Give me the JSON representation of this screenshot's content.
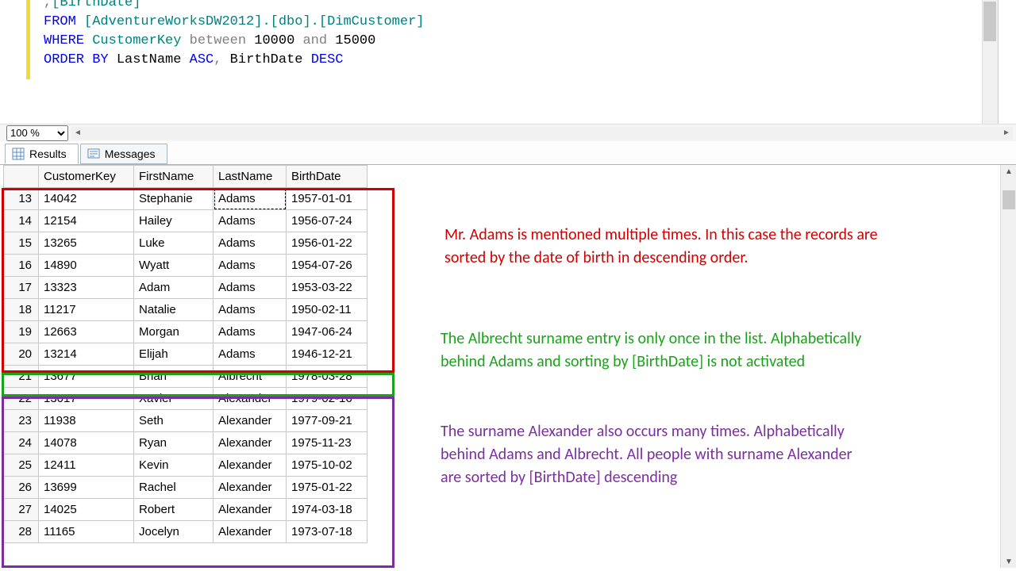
{
  "zoom": "100 %",
  "tabs": {
    "results": "Results",
    "messages": "Messages"
  },
  "sql": {
    "line0_pre": "      ,",
    "line0_col": "[BirthDate]",
    "line1_from": "FROM",
    "line1_db": " [AdventureWorksDW2012].[dbo].[DimCustomer]",
    "line2_where": "WHERE",
    "line2_col": " CustomerKey ",
    "line2_between": "between",
    "line2_space1": " ",
    "line2_n1": "10000",
    "line2_and": " and ",
    "line2_n2": "15000",
    "line3_order": "ORDER",
    "line3_sp1": " ",
    "line3_by": "BY",
    "line3_cols": " LastName ",
    "line3_asc": "ASC",
    "line3_comma": ",",
    "line3_cols2": " BirthDate ",
    "line3_desc": "DESC"
  },
  "columns": [
    "CustomerKey",
    "FirstName",
    "LastName",
    "BirthDate"
  ],
  "rows": [
    {
      "n": 13,
      "ck": "14042",
      "fn": "Stephanie",
      "ln": "Adams",
      "bd": "1957-01-01"
    },
    {
      "n": 14,
      "ck": "12154",
      "fn": "Hailey",
      "ln": "Adams",
      "bd": "1956-07-24"
    },
    {
      "n": 15,
      "ck": "13265",
      "fn": "Luke",
      "ln": "Adams",
      "bd": "1956-01-22"
    },
    {
      "n": 16,
      "ck": "14890",
      "fn": "Wyatt",
      "ln": "Adams",
      "bd": "1954-07-26"
    },
    {
      "n": 17,
      "ck": "13323",
      "fn": "Adam",
      "ln": "Adams",
      "bd": "1953-03-22"
    },
    {
      "n": 18,
      "ck": "11217",
      "fn": "Natalie",
      "ln": "Adams",
      "bd": "1950-02-11"
    },
    {
      "n": 19,
      "ck": "12663",
      "fn": "Morgan",
      "ln": "Adams",
      "bd": "1947-06-24"
    },
    {
      "n": 20,
      "ck": "13214",
      "fn": "Elijah",
      "ln": "Adams",
      "bd": "1946-12-21"
    },
    {
      "n": 21,
      "ck": "13677",
      "fn": "Brian",
      "ln": "Albrecht",
      "bd": "1978-03-28"
    },
    {
      "n": 22,
      "ck": "13017",
      "fn": "Xavier",
      "ln": "Alexander",
      "bd": "1979-02-16"
    },
    {
      "n": 23,
      "ck": "11938",
      "fn": "Seth",
      "ln": "Alexander",
      "bd": "1977-09-21"
    },
    {
      "n": 24,
      "ck": "14078",
      "fn": "Ryan",
      "ln": "Alexander",
      "bd": "1975-11-23"
    },
    {
      "n": 25,
      "ck": "12411",
      "fn": "Kevin",
      "ln": "Alexander",
      "bd": "1975-10-02"
    },
    {
      "n": 26,
      "ck": "13699",
      "fn": "Rachel",
      "ln": "Alexander",
      "bd": "1975-01-22"
    },
    {
      "n": 27,
      "ck": "14025",
      "fn": "Robert",
      "ln": "Alexander",
      "bd": "1974-03-18"
    },
    {
      "n": 28,
      "ck": "11165",
      "fn": "Jocelyn",
      "ln": "Alexander",
      "bd": "1973-07-18"
    }
  ],
  "annot": {
    "red": "Mr. Adams is mentioned multiple times. In this case the records are sorted by the date of birth in descending order.",
    "green": "The Albrecht surname entry is only once in the list. Alphabetically behind Adams and sorting by [BirthDate] is not activated",
    "purple": "The surname Alexander also occurs many times. Alphabetically behind Adams and Albrecht. All people with surname Alexander are sorted by [BirthDate] descending"
  }
}
